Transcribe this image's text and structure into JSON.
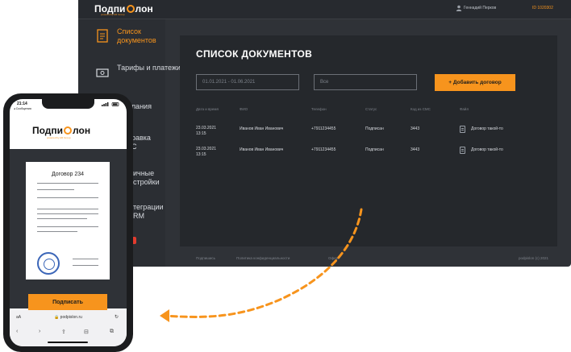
{
  "brand": {
    "name_left": "Подпи",
    "name_right": "лон",
    "tagline": "powered by AR Group",
    "accent": "#f7941d"
  },
  "desktop": {
    "header": {
      "user_name": "Геннадий Перков",
      "user_id": "ID 1020302"
    },
    "sidebar": {
      "items": [
        {
          "label": "Список документов",
          "icon": "documents-icon",
          "active": true
        },
        {
          "label": "Тарифы и платежи",
          "icon": "payments-icon",
          "active": false
        },
        {
          "label": "мпания",
          "icon": "company-icon",
          "active": false
        },
        {
          "label": "равка С",
          "icon": "sms-icon",
          "active": false
        },
        {
          "label": "ичные стройки",
          "icon": "settings-icon",
          "active": false
        },
        {
          "label": "теграции RM",
          "icon": "crm-icon",
          "active": false
        }
      ]
    },
    "main": {
      "title": "СПИСОК ДОКУМЕНТОВ",
      "date_range": "01.01.2021 - 01.06.2021",
      "search_placeholder": "Все",
      "add_button": "+ Добавить договор",
      "table": {
        "columns": [
          "Дата и время",
          "ФИО",
          "Телефон",
          "Статус",
          "Код из СМС",
          "Файл"
        ],
        "rows": [
          {
            "date": "23.03.2021",
            "time": "13:15",
            "name": "Иванов Иван Иванович",
            "phone": "+7911234455",
            "status": "Подписан",
            "code": "3443",
            "file": "Договор такой-то"
          },
          {
            "date": "23.03.2021",
            "time": "13:15",
            "name": "Иванов Иван Иванович",
            "phone": "+7911234455",
            "status": "Подписан",
            "code": "3443",
            "file": "Договор такой-то"
          }
        ]
      }
    },
    "footer": {
      "link1": "Подпишись",
      "link2": "Политика конфиденциальности",
      "link3": "Офер",
      "copyright": "podpislon (c) 2021"
    }
  },
  "phone": {
    "time": "21:14",
    "back_label": "◂ Сообщения",
    "document_title": "Договор 234",
    "sign_button": "Подписать",
    "browser": {
      "aa": "аА",
      "url": "🔒 podpislon.ru"
    }
  }
}
